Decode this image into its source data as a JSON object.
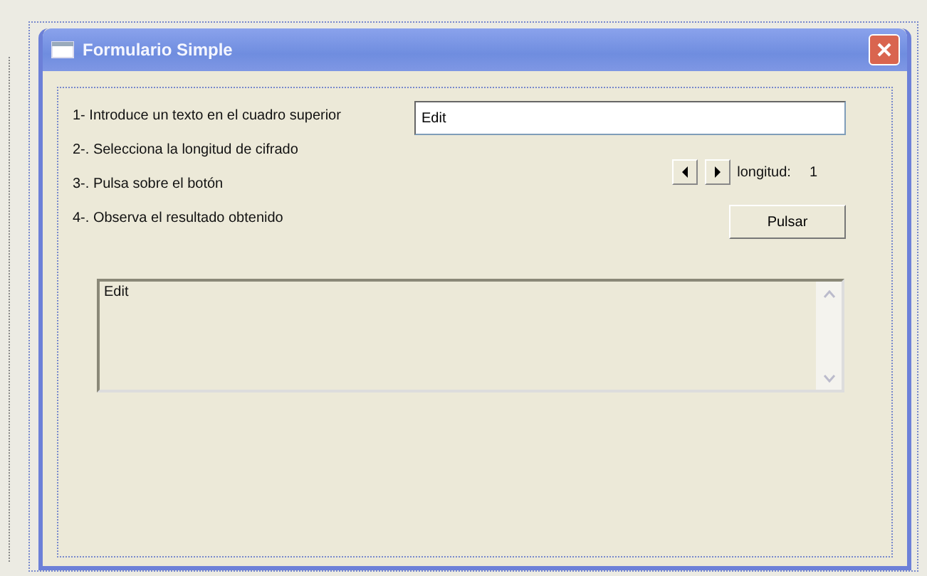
{
  "window": {
    "title": "Formulario Simple"
  },
  "instructions": [
    "1- Introduce un texto en el cuadro superior",
    "2-. Selecciona la longitud de cifrado",
    "3-. Pulsa sobre el botón",
    "4-. Observa el resultado obtenido"
  ],
  "text_input": {
    "value": "Edit"
  },
  "length": {
    "label": "longitud:",
    "value": "1"
  },
  "button": {
    "label": "Pulsar"
  },
  "output": {
    "value": "Edit"
  }
}
